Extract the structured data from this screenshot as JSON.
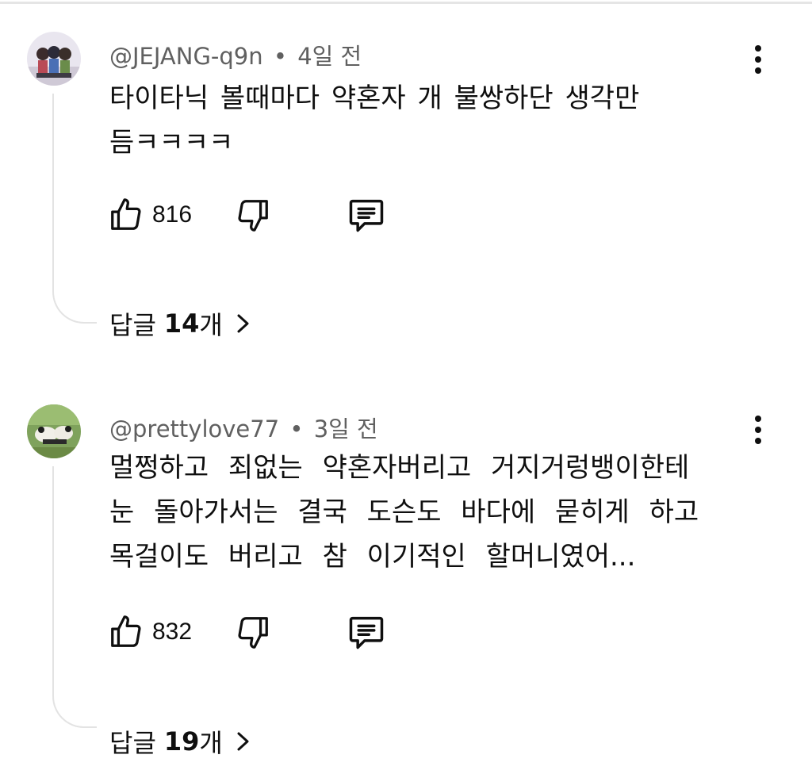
{
  "comments": [
    {
      "author": "@JEJANG-q9n",
      "separator": "•",
      "time": "4일 전",
      "lines": [
        "타이타닉 볼때마다 약혼자 개 불쌍하단 생각만",
        "듬ㅋㅋㅋㅋ"
      ],
      "like_count": "816",
      "replies": {
        "prefix": "답글",
        "count": "14",
        "suffix": "개"
      }
    },
    {
      "author": "@prettylove77",
      "separator": "•",
      "time": "3일 전",
      "lines": [
        "멀쩡하고 죄없는 약혼자버리고 거지거렁뱅이한테",
        "눈 돌아가서는 결국 도슨도 바다에 묻히게 하고",
        "목걸이도 버리고 참 이기적인 할머니였어..."
      ],
      "like_count": "832",
      "replies": {
        "prefix": "답글",
        "count": "19",
        "suffix": "개"
      }
    }
  ],
  "icons": {
    "like": "thumbs-up-icon",
    "dislike": "thumbs-down-icon",
    "reply": "comment-icon",
    "more": "more-vertical-icon",
    "chevron": "chevron-right-icon"
  },
  "colors": {
    "text": "#0f0f0f",
    "meta": "#606060",
    "thread_line": "#e3e3e3",
    "divider": "#e5e5e5"
  }
}
